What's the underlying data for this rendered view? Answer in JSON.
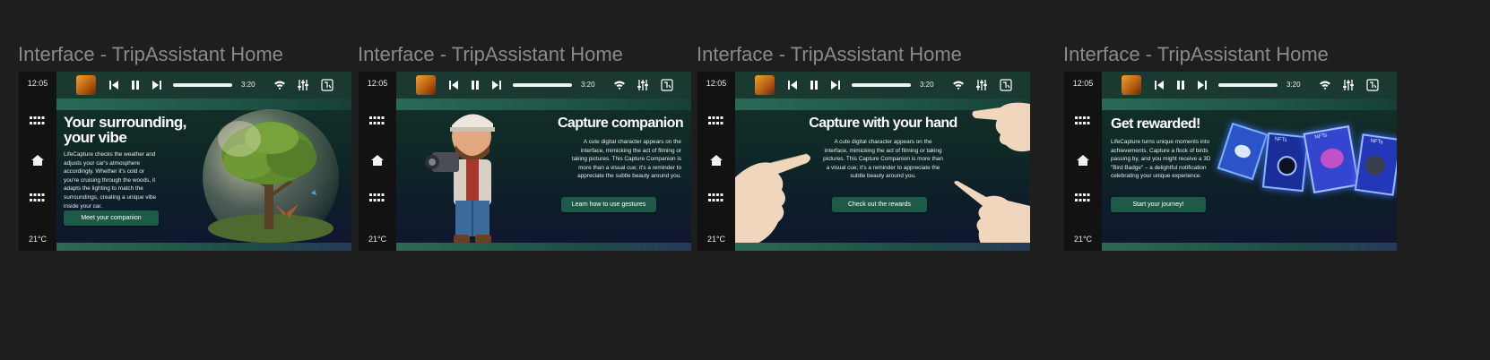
{
  "frames": [
    {
      "label": "Interface - TripAssistant Home",
      "clock": "12:05",
      "temperature": "21°C",
      "track_time": "3:20",
      "headline": "Your surrounding, your vibe",
      "body": "LifeCapture checks the weather and adjusts your car's atmosphere accordingly. Whether it's cold or you're cruising through the woods, it adapts the lighting to match the surroundings, creating a unique vibe inside your car.",
      "cta": "Meet your companion",
      "illustration": "glass-globe-tree"
    },
    {
      "label": "Interface - TripAssistant Home",
      "clock": "12:05",
      "temperature": "21°C",
      "track_time": "3:20",
      "headline": "Capture companion",
      "body": "A cute digital character appears on the interface, mimicking the act of filming or taking pictures. This Capture Companion is more than a visual cue; it's a reminder to appreciate the subtle beauty around you.",
      "cta": "Learn how to use gestures",
      "illustration": "cartoon-cameraman"
    },
    {
      "label": "Interface - TripAssistant Home",
      "clock": "12:05",
      "temperature": "21°C",
      "track_time": "3:20",
      "headline": "Capture with your hand",
      "body": "A cute digital character appears on the interface, mimicking the act of filming or taking pictures. This Capture Companion is more than a visual cue; it's a reminder to appreciate the subtle beauty around you.",
      "cta": "Check out the rewards",
      "illustration": "pointing-hands"
    },
    {
      "label": "Interface - TripAssistant Home",
      "clock": "12:05",
      "temperature": "21°C",
      "track_time": "3:20",
      "headline": "Get rewarded!",
      "body": "LifeCapture turns unique moments into achievements. Capture a flock of birds passing by, and you might receive a 3D \"Bird Badge\" – a delightful notification celebrating your unique experience.",
      "cta": "Start your journey!",
      "illustration": "nft-cards",
      "card_labels": [
        "NFTs",
        "NFTs",
        "NFTs"
      ]
    }
  ],
  "icons": {
    "thumb": "album-art-icon",
    "prev": "skip-back-icon",
    "pause": "pause-icon",
    "next": "skip-forward-icon",
    "wifi": "wifi-icon",
    "mixer": "sliders-icon",
    "flag": "language-icon",
    "apps": "grid-icon",
    "home": "home-icon"
  },
  "colors": {
    "background": "#1e1e1e",
    "rail": "#121212",
    "topbar": "#1a3a31",
    "accent": "#2a6a55",
    "button": "#1e5a48",
    "label": "#8a8a8a"
  }
}
